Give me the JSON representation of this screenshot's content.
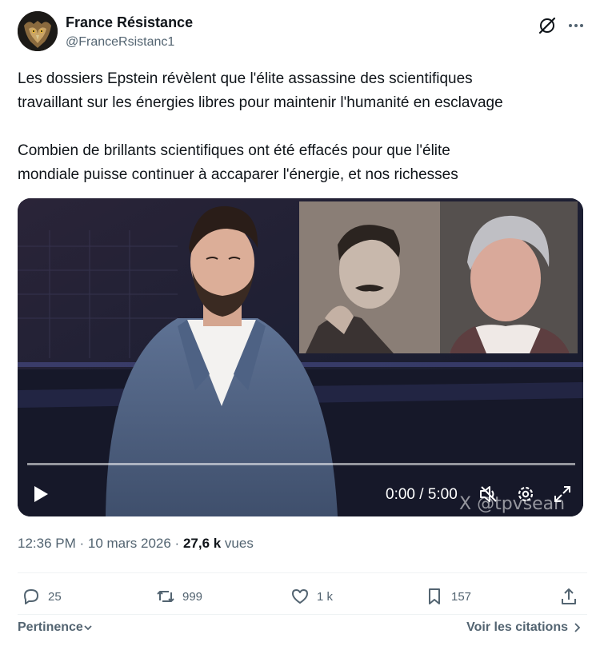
{
  "author": {
    "name": "France Résistance",
    "handle": "@FranceRsistanc1"
  },
  "tweet": {
    "lines_1": [
      "Les dossiers Epstein révèlent que l'élite assassine des scientifiques",
      "travaillant sur les énergies libres pour maintenir l'humanité en esclavage"
    ],
    "lines_2": [
      "Combien de brillants scientifiques ont été effacés pour que l'élite",
      "mondiale puisse continuer à accaparer l'énergie, et nos richesses"
    ]
  },
  "video": {
    "time_display": "0:00 / 5:00",
    "watermark": "@tpvsean",
    "progress": 0
  },
  "meta": {
    "timestamp": "12:36 PM · 10 mars 2026 · ",
    "views_count": "27,6 k",
    "views_label": " vues"
  },
  "stats": {
    "replies": "25",
    "reposts": "999",
    "likes": "1 k",
    "bookmarks": "157"
  },
  "footer": {
    "sort_label": "Pertinence",
    "quotes_link": "Voir les citations"
  },
  "icons": {
    "grok": "grok-icon",
    "more": "more-icon",
    "reply": "reply-icon",
    "repost": "repost-icon",
    "like": "like-icon",
    "bookmark": "bookmark-icon",
    "share": "share-icon",
    "play": "play-icon",
    "volume": "volume-icon",
    "settings": "settings-icon",
    "fullscreen": "fullscreen-icon"
  },
  "colors": {
    "text_primary": "#0f1419",
    "text_secondary": "#536471",
    "divider": "#eff3f4"
  }
}
